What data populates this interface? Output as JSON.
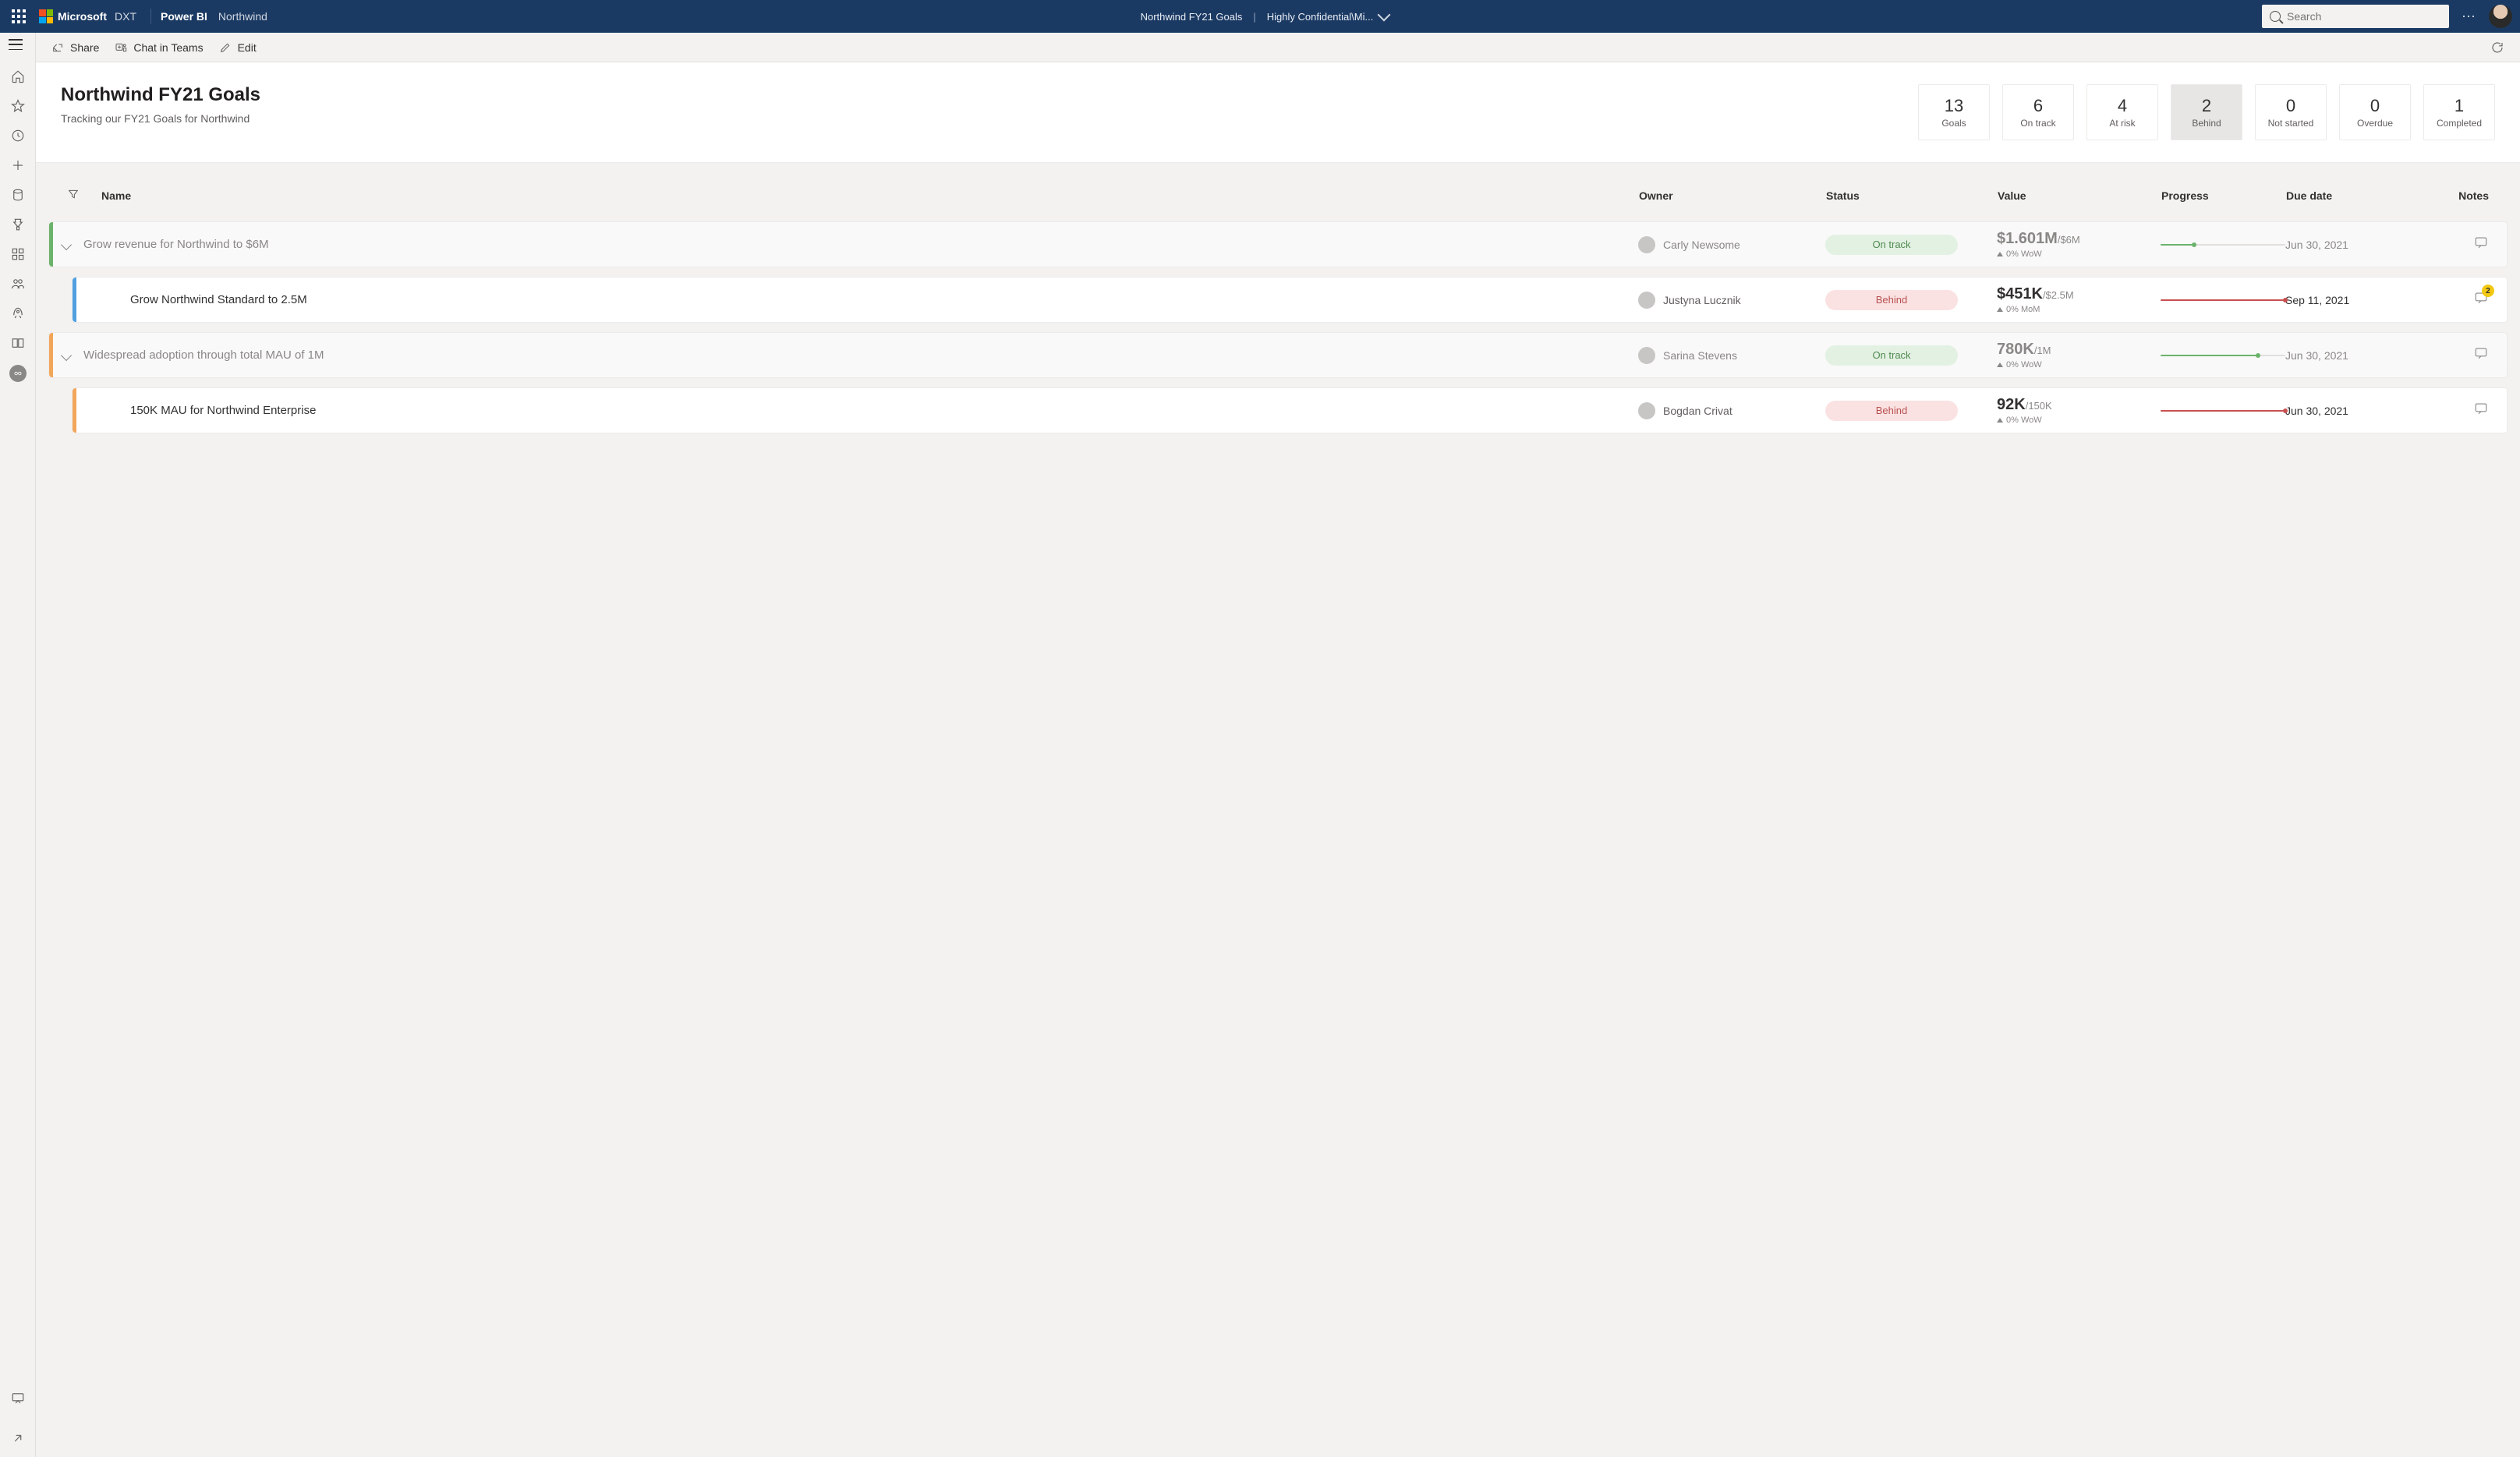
{
  "suite": {
    "brand_primary": "Microsoft",
    "brand_secondary": "DXT",
    "product": "Power BI",
    "workspace": "Northwind",
    "center_title": "Northwind FY21 Goals",
    "center_sensitivity": "Highly Confidential\\Mi...",
    "search_placeholder": "Search"
  },
  "toolbar": {
    "share": "Share",
    "chat": "Chat in Teams",
    "edit": "Edit"
  },
  "scorecard": {
    "title": "Northwind FY21 Goals",
    "subtitle": "Tracking our FY21 Goals for Northwind"
  },
  "kpis": [
    {
      "value": "13",
      "label": "Goals",
      "active": false
    },
    {
      "value": "6",
      "label": "On track",
      "active": false
    },
    {
      "value": "4",
      "label": "At risk",
      "active": false
    },
    {
      "value": "2",
      "label": "Behind",
      "active": true
    },
    {
      "value": "0",
      "label": "Not started",
      "active": false
    },
    {
      "value": "0",
      "label": "Overdue",
      "active": false
    },
    {
      "value": "1",
      "label": "Completed",
      "active": false
    }
  ],
  "columns": {
    "name": "Name",
    "owner": "Owner",
    "status": "Status",
    "value": "Value",
    "progress": "Progress",
    "due": "Due date",
    "notes": "Notes"
  },
  "colors": {
    "stripe_green": "#6bb36b",
    "stripe_blue": "#50a0e0",
    "stripe_orange": "#f2a65a",
    "progress_green": "#6bb36b",
    "progress_red": "#c85050"
  },
  "goals": [
    {
      "role": "parent",
      "stripe": "stripe_green",
      "name": "Grow revenue for Northwind to $6M",
      "owner": "Carly Newsome",
      "status": "On track",
      "status_class": "pill-ontrack",
      "value_main": "$1.601M",
      "value_target": "/$6M",
      "value_delta": "0% WoW",
      "progress_color": "progress_green",
      "progress_pct": 27,
      "due": "Jun 30, 2021",
      "note_badge": null
    },
    {
      "role": "child",
      "stripe": "stripe_blue",
      "name": "Grow Northwind Standard to 2.5M",
      "owner": "Justyna Lucznik",
      "status": "Behind",
      "status_class": "pill-behind",
      "value_main": "$451K",
      "value_target": "/$2.5M",
      "value_delta": "0% MoM",
      "progress_color": "progress_red",
      "progress_pct": 100,
      "due": "Sep 11, 2021",
      "note_badge": "2"
    },
    {
      "role": "parent",
      "stripe": "stripe_orange",
      "name": "Widespread adoption through total MAU of 1M",
      "owner": "Sarina Stevens",
      "status": "On track",
      "status_class": "pill-ontrack",
      "value_main": "780K",
      "value_target": "/1M",
      "value_delta": "0% WoW",
      "progress_color": "progress_green",
      "progress_pct": 78,
      "due": "Jun 30, 2021",
      "note_badge": null
    },
    {
      "role": "child",
      "stripe": "stripe_orange",
      "name": "150K MAU for Northwind Enterprise",
      "owner": "Bogdan Crivat",
      "status": "Behind",
      "status_class": "pill-behind",
      "value_main": "92K",
      "value_target": "/150K",
      "value_delta": "0% WoW",
      "progress_color": "progress_red",
      "progress_pct": 100,
      "due": "Jun 30, 2021",
      "note_badge": null
    }
  ]
}
